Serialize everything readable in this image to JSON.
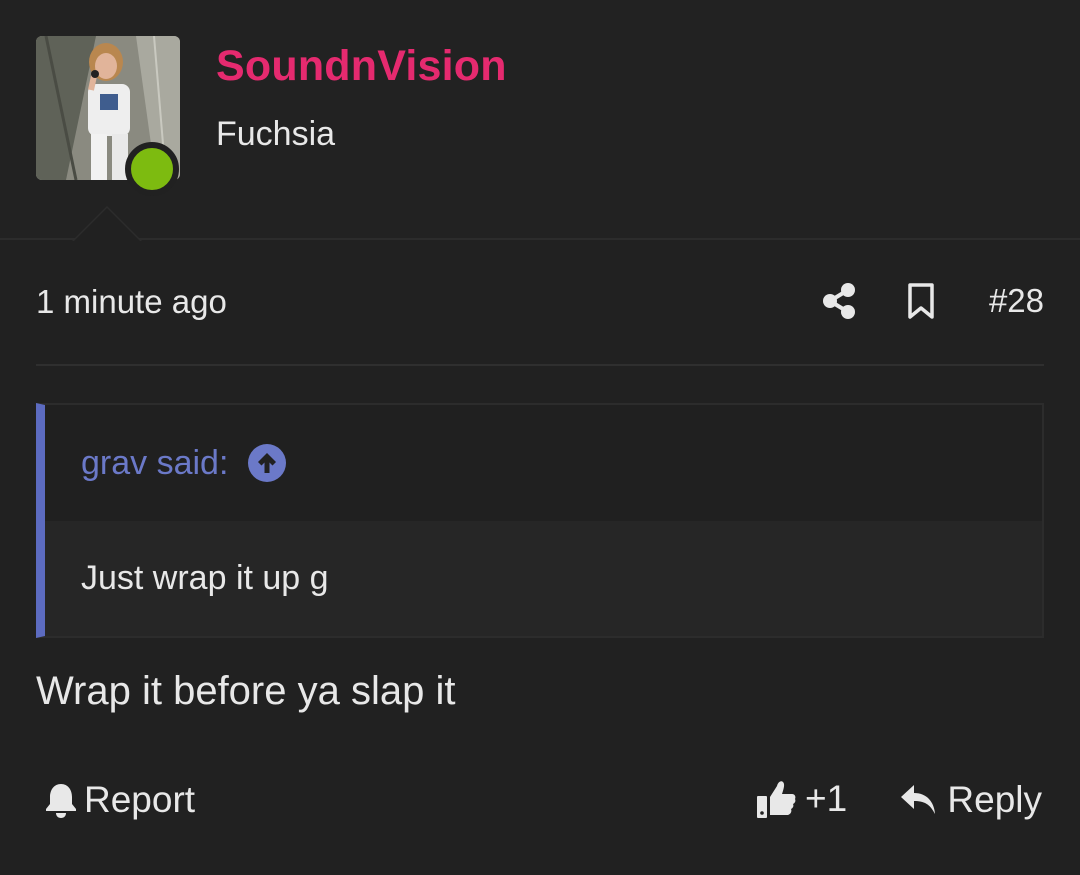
{
  "user": {
    "name": "SoundnVision",
    "title": "Fuchsia",
    "status_icon": "online-status-dot",
    "name_color": "#e52a6f",
    "status_color": "#7dbb10"
  },
  "post": {
    "time": "1 minute ago",
    "number": "#28",
    "share_icon": "share-icon",
    "bookmark_icon": "bookmark-icon",
    "message": "Wrap it before ya slap it"
  },
  "quote": {
    "author_label": "grav said:",
    "jump_icon": "arrow-up-circle-icon",
    "text": "Just wrap it up g",
    "accent_color": "#5c6bc0"
  },
  "actions": {
    "report_label": "Report",
    "report_icon": "bell-icon",
    "like_label": "+1",
    "like_icon": "thumbs-up-icon",
    "reply_label": "Reply",
    "reply_icon": "reply-arrow-icon"
  }
}
